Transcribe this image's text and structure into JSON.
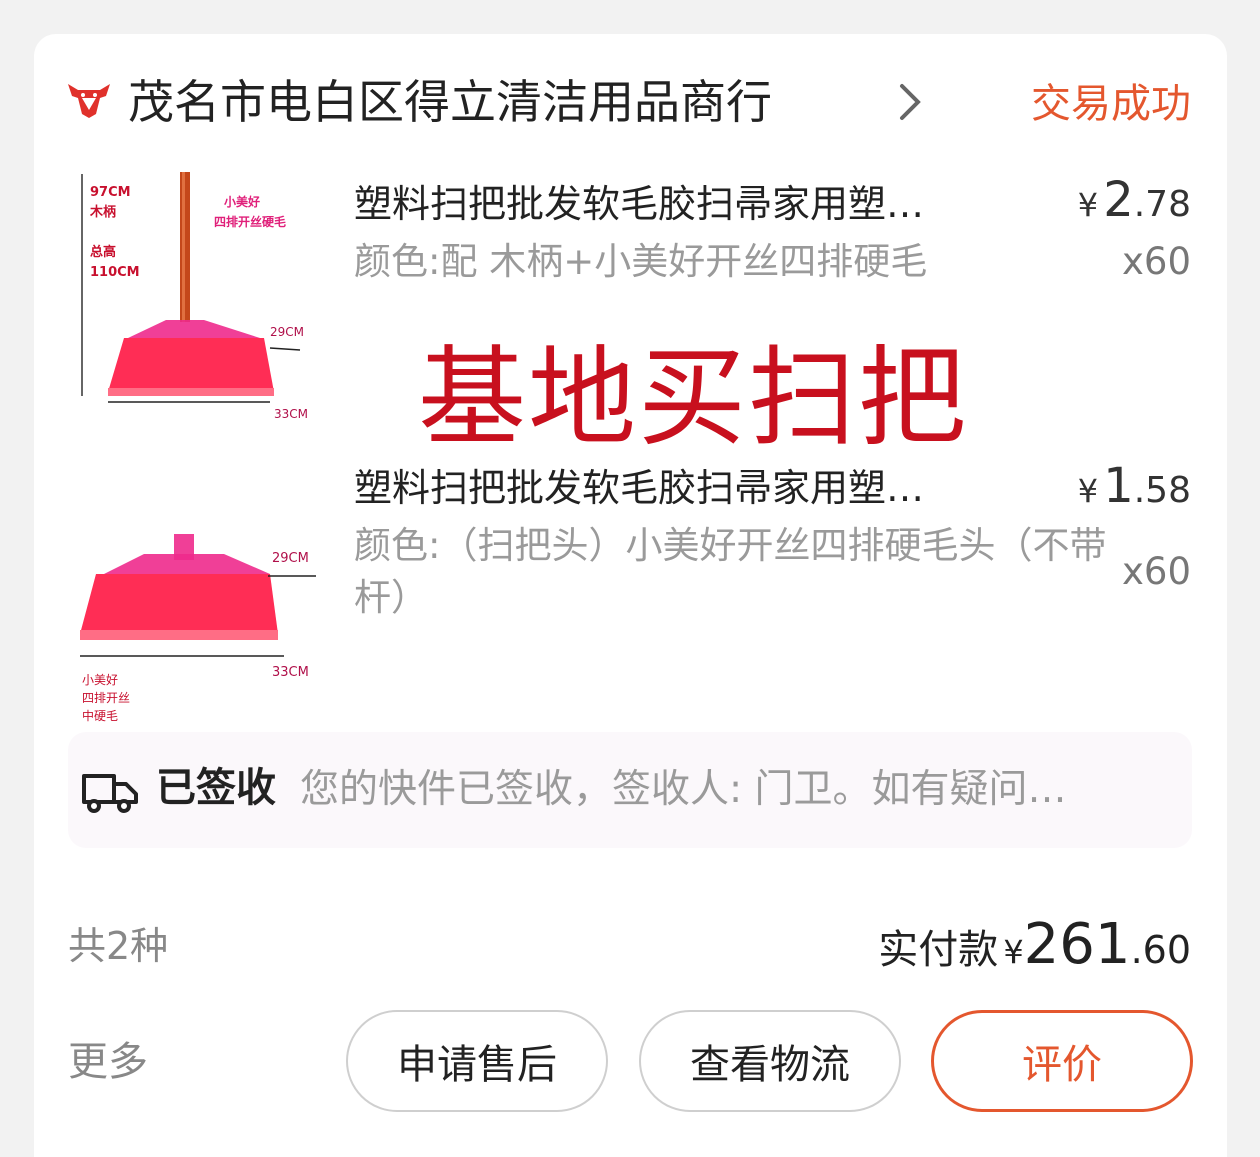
{
  "shop": {
    "logo": "bull-head-logo",
    "name": "茂名市电白区得立清洁用品商行",
    "status": "交易成功"
  },
  "products": [
    {
      "title": "塑料扫把批发软毛胶扫帚家用塑…",
      "spec": "颜色:配 木柄+小美好开丝四排硬毛",
      "price_symbol": "¥",
      "price_int": "2",
      "price_dec": ".78",
      "qty": "x60",
      "image": {
        "height_label": "97CM",
        "handle_label": "木柄",
        "total_label": "总高",
        "total_value": "110CM",
        "brand_label": "小美好",
        "brand_sub": "四排开丝硬毛",
        "head_height": "29CM",
        "head_width": "33CM"
      }
    },
    {
      "title": "塑料扫把批发软毛胶扫帚家用塑…",
      "spec": "颜色:（扫把头）小美好开丝四排硬毛头（不带杆）",
      "price_symbol": "¥",
      "price_int": "1",
      "price_dec": ".58",
      "qty": "x60",
      "image": {
        "head_height": "29CM",
        "head_width": "33CM",
        "brand_line1": "小美好",
        "brand_line2": "四排开丝",
        "brand_line3": "中硬毛"
      }
    }
  ],
  "watermark": "基地买扫把",
  "logistics": {
    "icon": "truck-icon",
    "status": "已签收",
    "detail": "您的快件已签收，签收人: 门卫。如有疑问…"
  },
  "summary": {
    "kinds": "共2种",
    "paid_label": "实付款",
    "paid_symbol": "¥",
    "paid_int": "261",
    "paid_dec": ".60"
  },
  "actions": {
    "more": "更多",
    "after_sale": "申请售后",
    "view_logistics": "查看物流",
    "review": "评价"
  },
  "colors": {
    "accent": "#e4572e",
    "watermark": "#c8101e",
    "broom": "#ff2d55"
  }
}
